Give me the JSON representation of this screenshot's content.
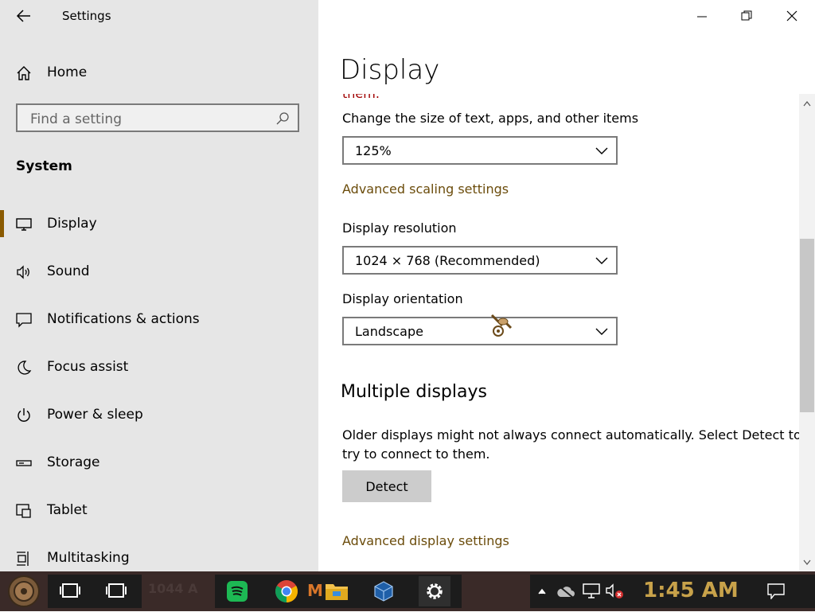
{
  "window": {
    "title": "Settings"
  },
  "sidebar": {
    "home_label": "Home",
    "search_placeholder": "Find a setting",
    "section_label": "System",
    "items": [
      {
        "label": "Display",
        "icon": "monitor-icon"
      },
      {
        "label": "Sound",
        "icon": "speaker-icon"
      },
      {
        "label": "Notifications & actions",
        "icon": "notification-icon"
      },
      {
        "label": "Focus assist",
        "icon": "moon-icon"
      },
      {
        "label": "Power & sleep",
        "icon": "power-icon"
      },
      {
        "label": "Storage",
        "icon": "storage-icon"
      },
      {
        "label": "Tablet",
        "icon": "tablet-icon"
      },
      {
        "label": "Multitasking",
        "icon": "multitasking-icon"
      }
    ]
  },
  "main": {
    "page_title": "Display",
    "cut_text": "them.",
    "scale_label": "Change the size of text, apps, and other items",
    "scale_value": "125%",
    "advanced_scaling_link": "Advanced scaling settings",
    "resolution_label": "Display resolution",
    "resolution_value": "1024 × 768 (Recommended)",
    "orientation_label": "Display orientation",
    "orientation_value": "Landscape",
    "multiple_heading": "Multiple displays",
    "multiple_desc_line1": "Older displays might not always connect automatically. Select Detect to",
    "multiple_desc_line2": "try to connect to them.",
    "detect_button": "Detect",
    "advanced_display_link": "Advanced display settings"
  },
  "taskbar": {
    "clock": "1:45 AM",
    "ghost_text_1": "1044 A",
    "ghost_text_2": "M"
  },
  "colors": {
    "accent": "#8a5a00",
    "link": "#6b4c0b",
    "sidebar_bg": "#e6e6e6",
    "clock": "#c8a24a",
    "taskbar_bg": "#3a2a28"
  }
}
